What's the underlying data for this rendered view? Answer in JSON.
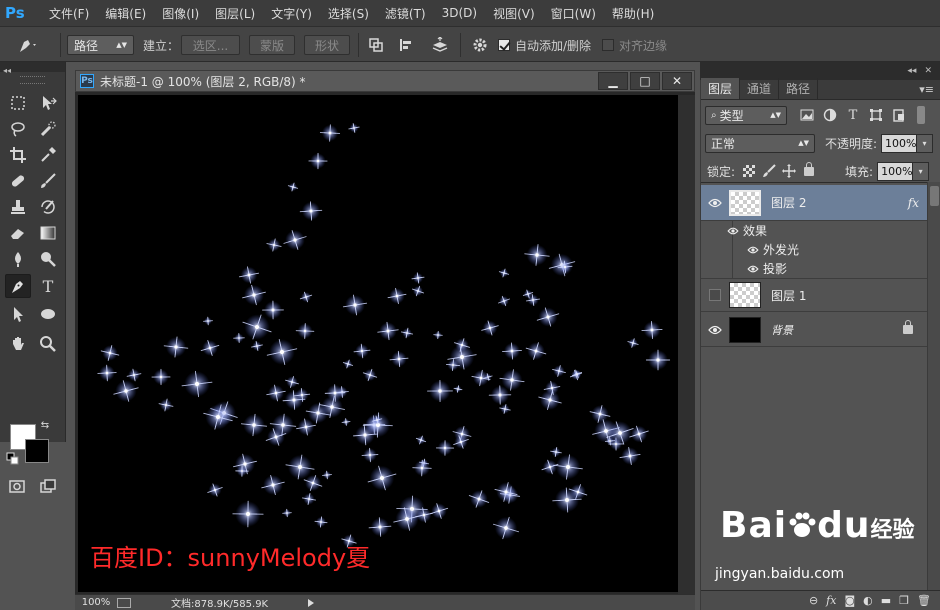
{
  "app": {
    "logo": "Ps"
  },
  "menu": [
    "文件(F)",
    "编辑(E)",
    "图像(I)",
    "图层(L)",
    "文字(Y)",
    "选择(S)",
    "滤镜(T)",
    "3D(D)",
    "视图(V)",
    "窗口(W)",
    "帮助(H)"
  ],
  "options": {
    "mode_select": "路径",
    "build_label": "建立：",
    "selection_btn": "选区...",
    "mask_btn": "蒙版",
    "shape_btn": "形状",
    "auto_add_delete": "自动添加/删除",
    "align_edges": "对齐边缘",
    "auto_add_checked": true
  },
  "document": {
    "title": "未标题-1 @ 100% (图层 2, RGB/8) *",
    "tab_icon": "Ps",
    "minimize": "▁",
    "maximize": "□",
    "close": "✕"
  },
  "status": {
    "zoom": "100%",
    "doc_info": "文档:878.9K/585.9K"
  },
  "watermark": "百度ID：sunnyMelody夏",
  "layers_panel": {
    "tabs": [
      "图层",
      "通道",
      "路径"
    ],
    "filter_select": "类型",
    "blend_mode": "正常",
    "opacity_label": "不透明度:",
    "opacity_value": "100%",
    "lock_label": "锁定:",
    "fill_label": "填充:",
    "fill_value": "100%",
    "layers": [
      {
        "name": "图层 2",
        "visible": true,
        "selected": true,
        "fx": "fx"
      },
      {
        "name": "图层 1",
        "visible": false,
        "selected": false
      },
      {
        "name": "背景",
        "visible": true,
        "selected": false,
        "locked": true
      }
    ],
    "effects_label": "效果",
    "effects": [
      "外发光",
      "投影"
    ]
  },
  "baidu": {
    "brand": "Bai",
    "brand2": "du",
    "cn": "经验",
    "url": "jingyan.baidu.com"
  },
  "colors": {
    "foreground": "#ffffff",
    "background": "#000000",
    "star": "#cfd8ff",
    "watermark": "#ff2a2a"
  },
  "chart_data": null
}
